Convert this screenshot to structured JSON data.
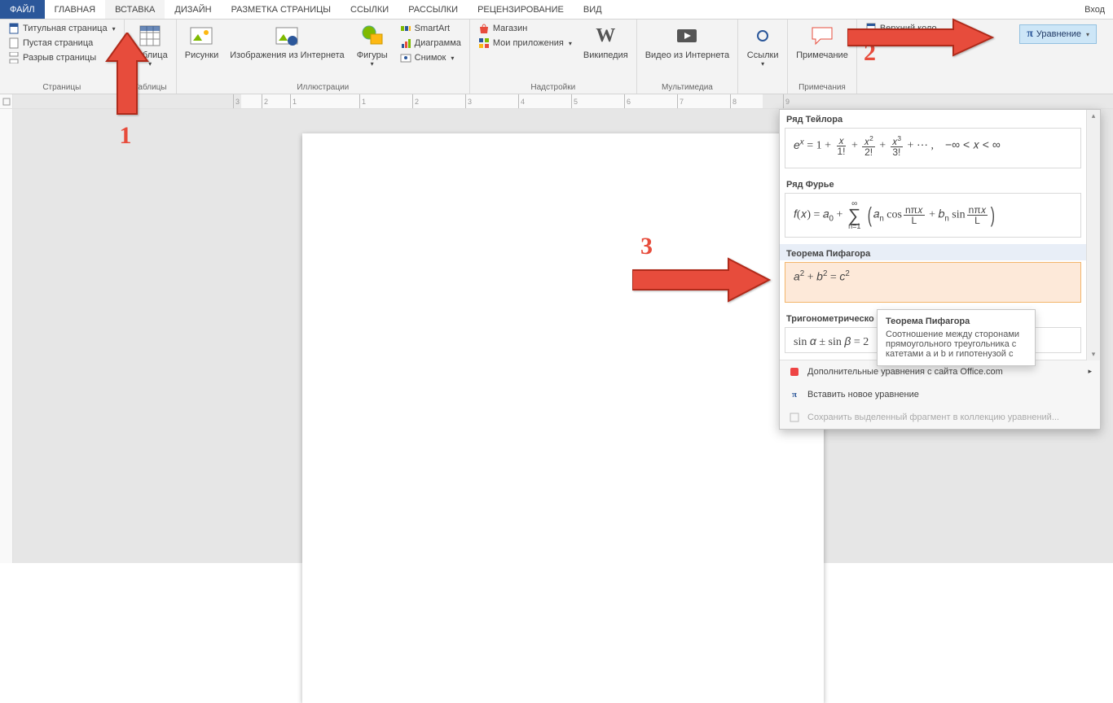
{
  "signin": "Вход",
  "tabs": [
    "ФАЙЛ",
    "ГЛАВНАЯ",
    "ВСТАВКА",
    "ДИЗАЙН",
    "РАЗМЕТКА СТРАНИЦЫ",
    "ССЫЛКИ",
    "РАССЫЛКИ",
    "РЕЦЕНЗИРОВАНИЕ",
    "ВИД"
  ],
  "activeTab": "ВСТАВКА",
  "ribbon": {
    "pages": {
      "label": "Страницы",
      "cover": "Титульная страница",
      "blank": "Пустая страница",
      "break": "Разрыв страницы"
    },
    "tables": {
      "label": "Таблицы",
      "btn": "Таблица"
    },
    "illustrations": {
      "label": "Иллюстрации",
      "pictures": "Рисунки",
      "online": "Изображения из Интернета",
      "shapes": "Фигуры",
      "smartart": "SmartArt",
      "chart": "Диаграмма",
      "screenshot": "Снимок"
    },
    "addins": {
      "label": "Надстройки",
      "store": "Магазин",
      "myapps": "Мои приложения",
      "wiki": "Википедия"
    },
    "media": {
      "label": "Мультимедиа",
      "video": "Видео из Интернета"
    },
    "links": {
      "label": "",
      "btn": "Ссылки"
    },
    "comments": {
      "label": "Примечания",
      "btn": "Примечание"
    },
    "header_top": "Верхний коло",
    "equation_button": "Уравнение"
  },
  "ruler_ticks": [
    "3",
    "2",
    "1",
    "1",
    "2",
    "3",
    "4",
    "5",
    "6",
    "7",
    "8",
    "9"
  ],
  "gallery": {
    "taylor_head": "Ряд Тейлора",
    "taylor_tail": "−∞ < 𝑥 < ∞",
    "fourier_head": "Ряд Фурье",
    "pythag_head": "Теорема Пифагора",
    "pythag_formula": "a² + b² = c²",
    "trig_head": "Тригонометрическо",
    "trig_formula_lead": "sin α ± sin β = 2",
    "footer_more": "Дополнительные уравнения с сайта Office.com",
    "footer_new": "Вставить новое уравнение",
    "footer_save": "Сохранить выделенный фрагмент в коллекцию уравнений..."
  },
  "tooltip": {
    "title": "Теорема Пифагора",
    "body": "Соотношение между сторонами прямоугольного треугольника с катетами a и b и гипотенузой c"
  },
  "anno": {
    "n1": "1",
    "n2": "2",
    "n3": "3"
  }
}
